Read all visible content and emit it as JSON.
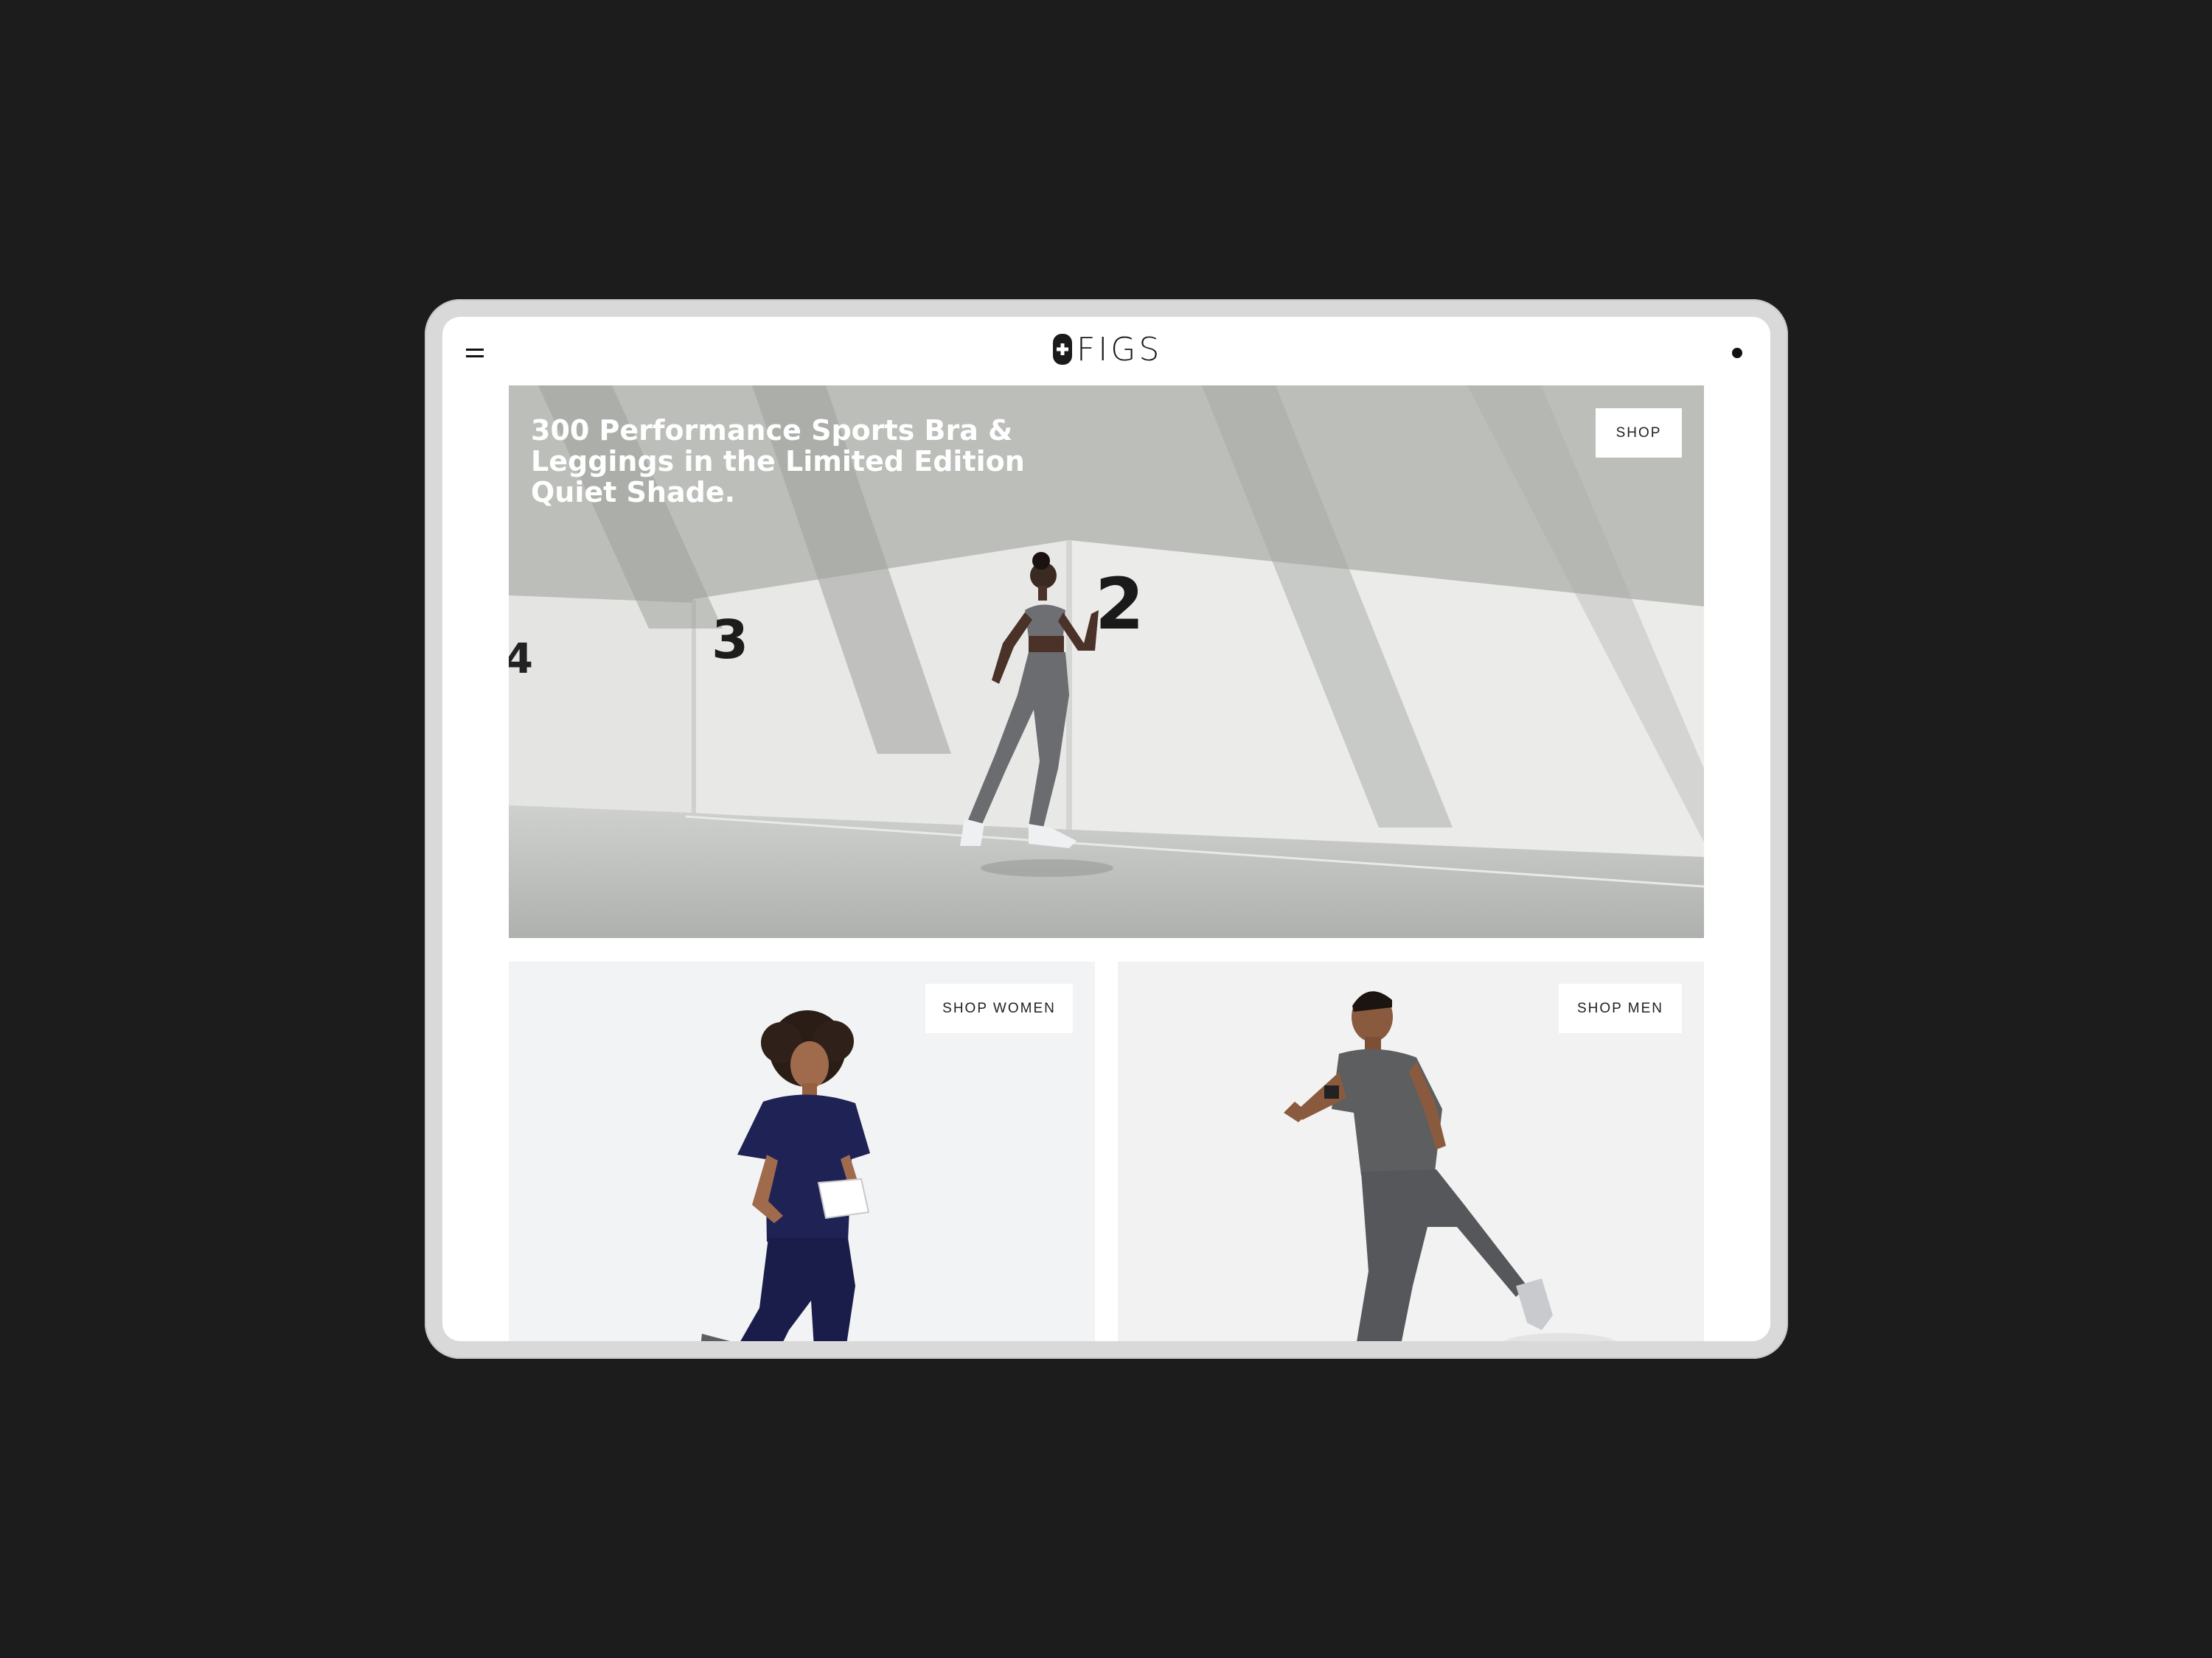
{
  "header": {
    "menu_icon": "hamburger-menu-icon",
    "logo_text": "FIGS",
    "logo_icon": "figs-cross-badge-icon",
    "cart_icon": "cart-dot-icon"
  },
  "hero": {
    "title": "300 Performance Sports Bra & Leggings in the Limited Edition Quiet Shade.",
    "button_label": "SHOP",
    "wall_numbers": [
      "4",
      "3",
      "2"
    ]
  },
  "tiles": {
    "women_button_label": "SHOP WOMEN",
    "men_button_label": "SHOP MEN"
  },
  "colors": {
    "page_background": "#1c1c1c",
    "device_frame": "#d9d9d9",
    "women_scrubs": "#1f2254",
    "men_scrubs": "#5c5e60"
  }
}
